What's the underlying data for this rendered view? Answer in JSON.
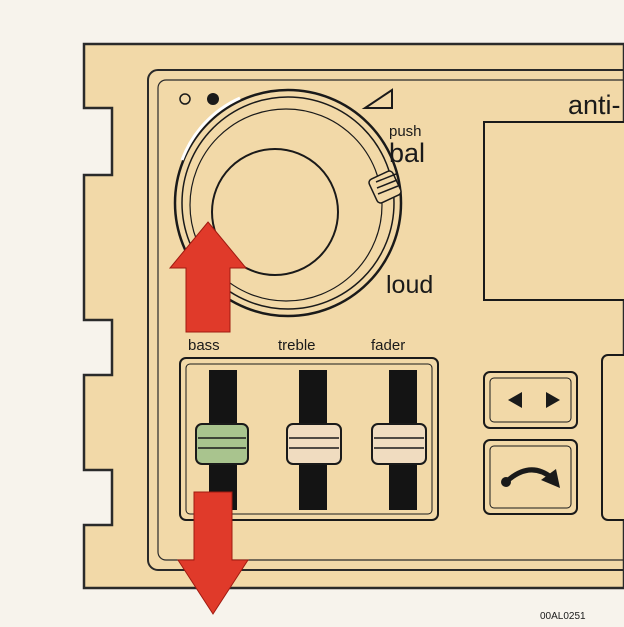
{
  "labels": {
    "push": "push",
    "bal": "bal",
    "loud": "loud",
    "anti": "anti-",
    "bass": "bass",
    "treble": "treble",
    "fader": "fader",
    "figure_code": "00AL0251"
  },
  "colors": {
    "panel": "#f2d9a8",
    "panel_outline": "#2a2a2a",
    "arrow": "#e03a2a",
    "bass_slider": "#a9c48e",
    "other_sliders": "#f0dcc0"
  },
  "icons": {
    "dot_open": "circle-outline-icon",
    "dot_filled": "circle-filled-icon",
    "volume": "volume-wedge-icon",
    "seek": "seek-left-right-icon",
    "reverse": "reverse-curve-icon"
  }
}
